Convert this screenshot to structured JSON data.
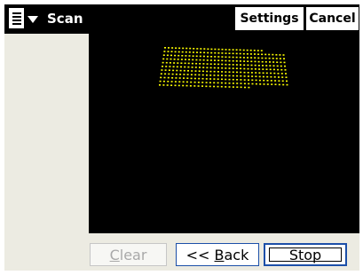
{
  "titlebar": {
    "title": "Scan",
    "settings_label": "Settings",
    "cancel_label": "Cancel",
    "menu_icon": "start-menu-icon"
  },
  "viewer": {
    "background": "#000000",
    "point_color": "#ffff00"
  },
  "buttons": {
    "clear": {
      "accel": "C",
      "rest": "lear",
      "enabled": false
    },
    "back": {
      "prefix": "<< ",
      "accel": "B",
      "rest": "ack"
    },
    "stop": {
      "accel": "S",
      "rest": "top"
    }
  },
  "colors": {
    "titlebar": "#000000",
    "panel": "#ecebe2",
    "focus_border": "#1c4fa8"
  }
}
